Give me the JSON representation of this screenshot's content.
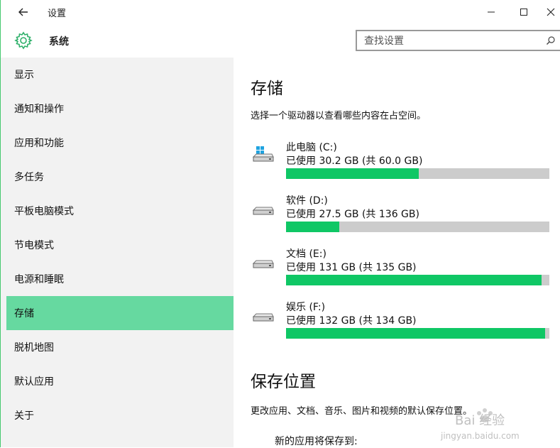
{
  "window": {
    "title": "设置"
  },
  "header": {
    "title": "系统",
    "search_placeholder": "查找设置"
  },
  "sidebar": {
    "items": [
      {
        "label": "显示"
      },
      {
        "label": "通知和操作"
      },
      {
        "label": "应用和功能"
      },
      {
        "label": "多任务"
      },
      {
        "label": "平板电脑模式"
      },
      {
        "label": "节电模式"
      },
      {
        "label": "电源和睡眠"
      },
      {
        "label": "存储",
        "active": true
      },
      {
        "label": "脱机地图"
      },
      {
        "label": "默认应用"
      },
      {
        "label": "关于"
      }
    ]
  },
  "main": {
    "storage": {
      "heading": "存储",
      "description": "选择一个驱动器以查看哪些内容在占空间。",
      "drives": [
        {
          "name": "此电脑 (C:)",
          "usage": "已使用 30.2 GB (共 60.0 GB)",
          "used_fraction": 0.503,
          "icon": "windows-drive-icon"
        },
        {
          "name": "软件 (D:)",
          "usage": "已使用 27.5 GB (共 136 GB)",
          "used_fraction": 0.202,
          "icon": "drive-icon"
        },
        {
          "name": "文档 (E:)",
          "usage": "已使用 131 GB (共 135 GB)",
          "used_fraction": 0.97,
          "icon": "drive-icon"
        },
        {
          "name": "娱乐 (F:)",
          "usage": "已使用 132 GB (共 134 GB)",
          "used_fraction": 0.985,
          "icon": "drive-icon"
        }
      ]
    },
    "save_location": {
      "heading": "保存位置",
      "description": "更改应用、文档、音乐、图片和视频的默认保存位置。",
      "new_apps_label": "新的应用将保存到:"
    }
  },
  "watermark": {
    "text": "Bai 经验",
    "url": "jingyan.baidu.com"
  },
  "colors": {
    "accent": "#0fc765",
    "selected_nav": "#66d9a0",
    "sidebar_bg": "#f2f2f2",
    "bar_bg": "#cccccc"
  }
}
